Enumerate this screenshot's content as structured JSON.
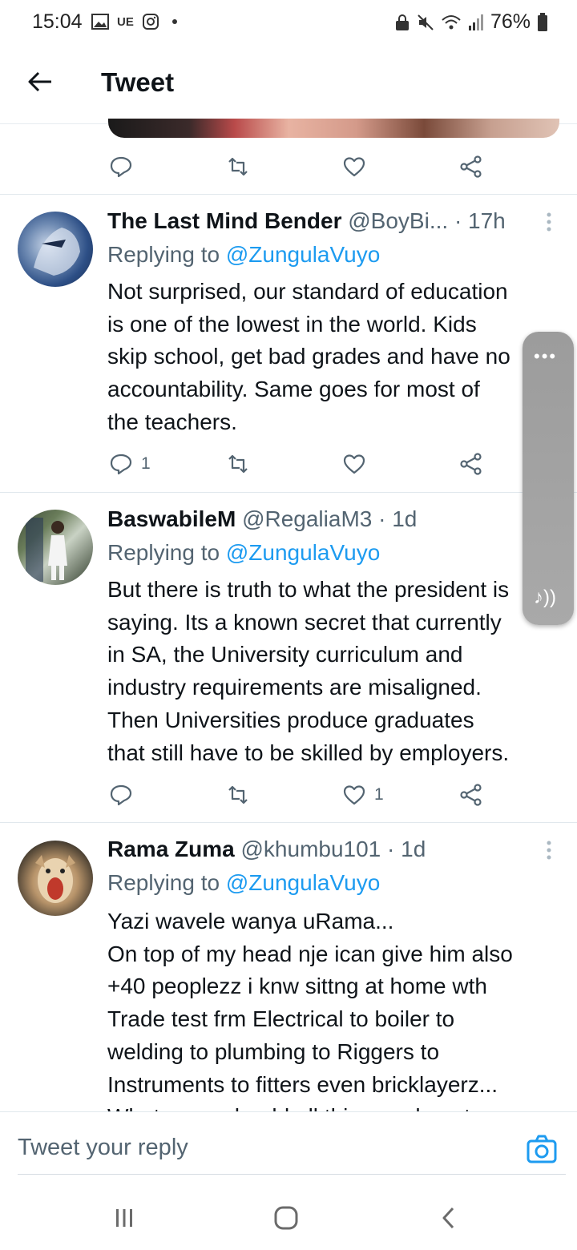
{
  "status_bar": {
    "time": "15:04",
    "carrier_label": "UE",
    "battery": "76%",
    "icons": [
      "image-icon",
      "instagram-icon",
      "notification-dot",
      "lock-icon",
      "mute-icon",
      "wifi-icon",
      "signal-icon",
      "battery-icon"
    ]
  },
  "header": {
    "title": "Tweet",
    "back_icon": "arrow-left-icon"
  },
  "top_tweet_actions": {
    "reply_count": "",
    "retweet_count": "",
    "like_count": ""
  },
  "tweets": [
    {
      "name": "The Last Mind Bender",
      "handle": "@BoyBi...",
      "time": "· 17h",
      "replying_prefix": "Replying to ",
      "replying_to": "@ZungulaVuyo",
      "body": "Not surprised, our standard of education\nis one of the lowest in the world. Kids\nskip school, get bad grades and have no\naccountability. Same goes for most of\nthe teachers.",
      "reply_count": "1",
      "retweet_count": "",
      "like_count": ""
    },
    {
      "name": "BaswabileM",
      "handle": "@RegaliaM3",
      "time": "· 1d",
      "replying_prefix": "Replying to ",
      "replying_to": "@ZungulaVuyo",
      "body": "But there is truth to what the president is\nsaying. Its a known secret that currently\nin SA, the University curriculum and\nindustry requirements are misaligned.\nThen Universities produce graduates\nthat still have to be skilled by employers.",
      "reply_count": "",
      "retweet_count": "",
      "like_count": "1"
    },
    {
      "name": "Rama Zuma",
      "handle": "@khumbu101",
      "time": "· 1d",
      "replying_prefix": "Replying to ",
      "replying_to": "@ZungulaVuyo",
      "body": "Yazi wavele wanya uRama...\nOn top of my head nje ican give him also\n+40 peoplezz i knw sittng at home wth\nTrade test frm Electrical to boiler to\nwelding to plumbing to Riggers to\nInstruments to fitters even bricklayerz...\nWhat more should all this people get"
    }
  ],
  "overlay": {
    "dots": "•••",
    "music_glyph": "♪))"
  },
  "reply_bar": {
    "placeholder": "Tweet your reply"
  },
  "colors": {
    "accent": "#1d9bf0",
    "text_primary": "#0f1419",
    "text_secondary": "#536471",
    "divider": "#e1e8ed"
  }
}
